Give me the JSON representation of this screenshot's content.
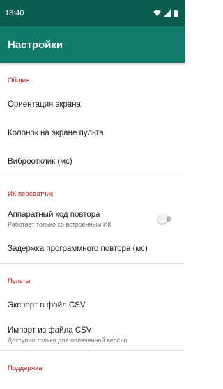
{
  "status_bar": {
    "time": "18:40",
    "icons": [
      "wifi-icon",
      "signal-icon",
      "battery-icon"
    ]
  },
  "app_bar": {
    "title": "Настройки"
  },
  "colors": {
    "status_bar": "#0b5d50",
    "app_bar": "#107a68",
    "section_header": "#b71c1c"
  },
  "sections": [
    {
      "header": "Общие",
      "items": [
        {
          "title": "Ориентация экрана"
        },
        {
          "title": "Колонок на экране пульта"
        },
        {
          "title": "Виброотклик (мс)"
        }
      ]
    },
    {
      "header": "ИК передатчик",
      "items": [
        {
          "title": "Аппаратный код повтора",
          "summary": "Работает только со встроенным ИК",
          "toggle": false
        },
        {
          "title": "Задержка программного повтора (мс)"
        }
      ]
    },
    {
      "header": "Пульты",
      "items": [
        {
          "title": "Экспорт в файл CSV"
        },
        {
          "title": "Импорт из файла CSV",
          "summary": "Доступно только для оплаченной версии"
        }
      ]
    },
    {
      "header": "Поддержка",
      "items": []
    }
  ]
}
